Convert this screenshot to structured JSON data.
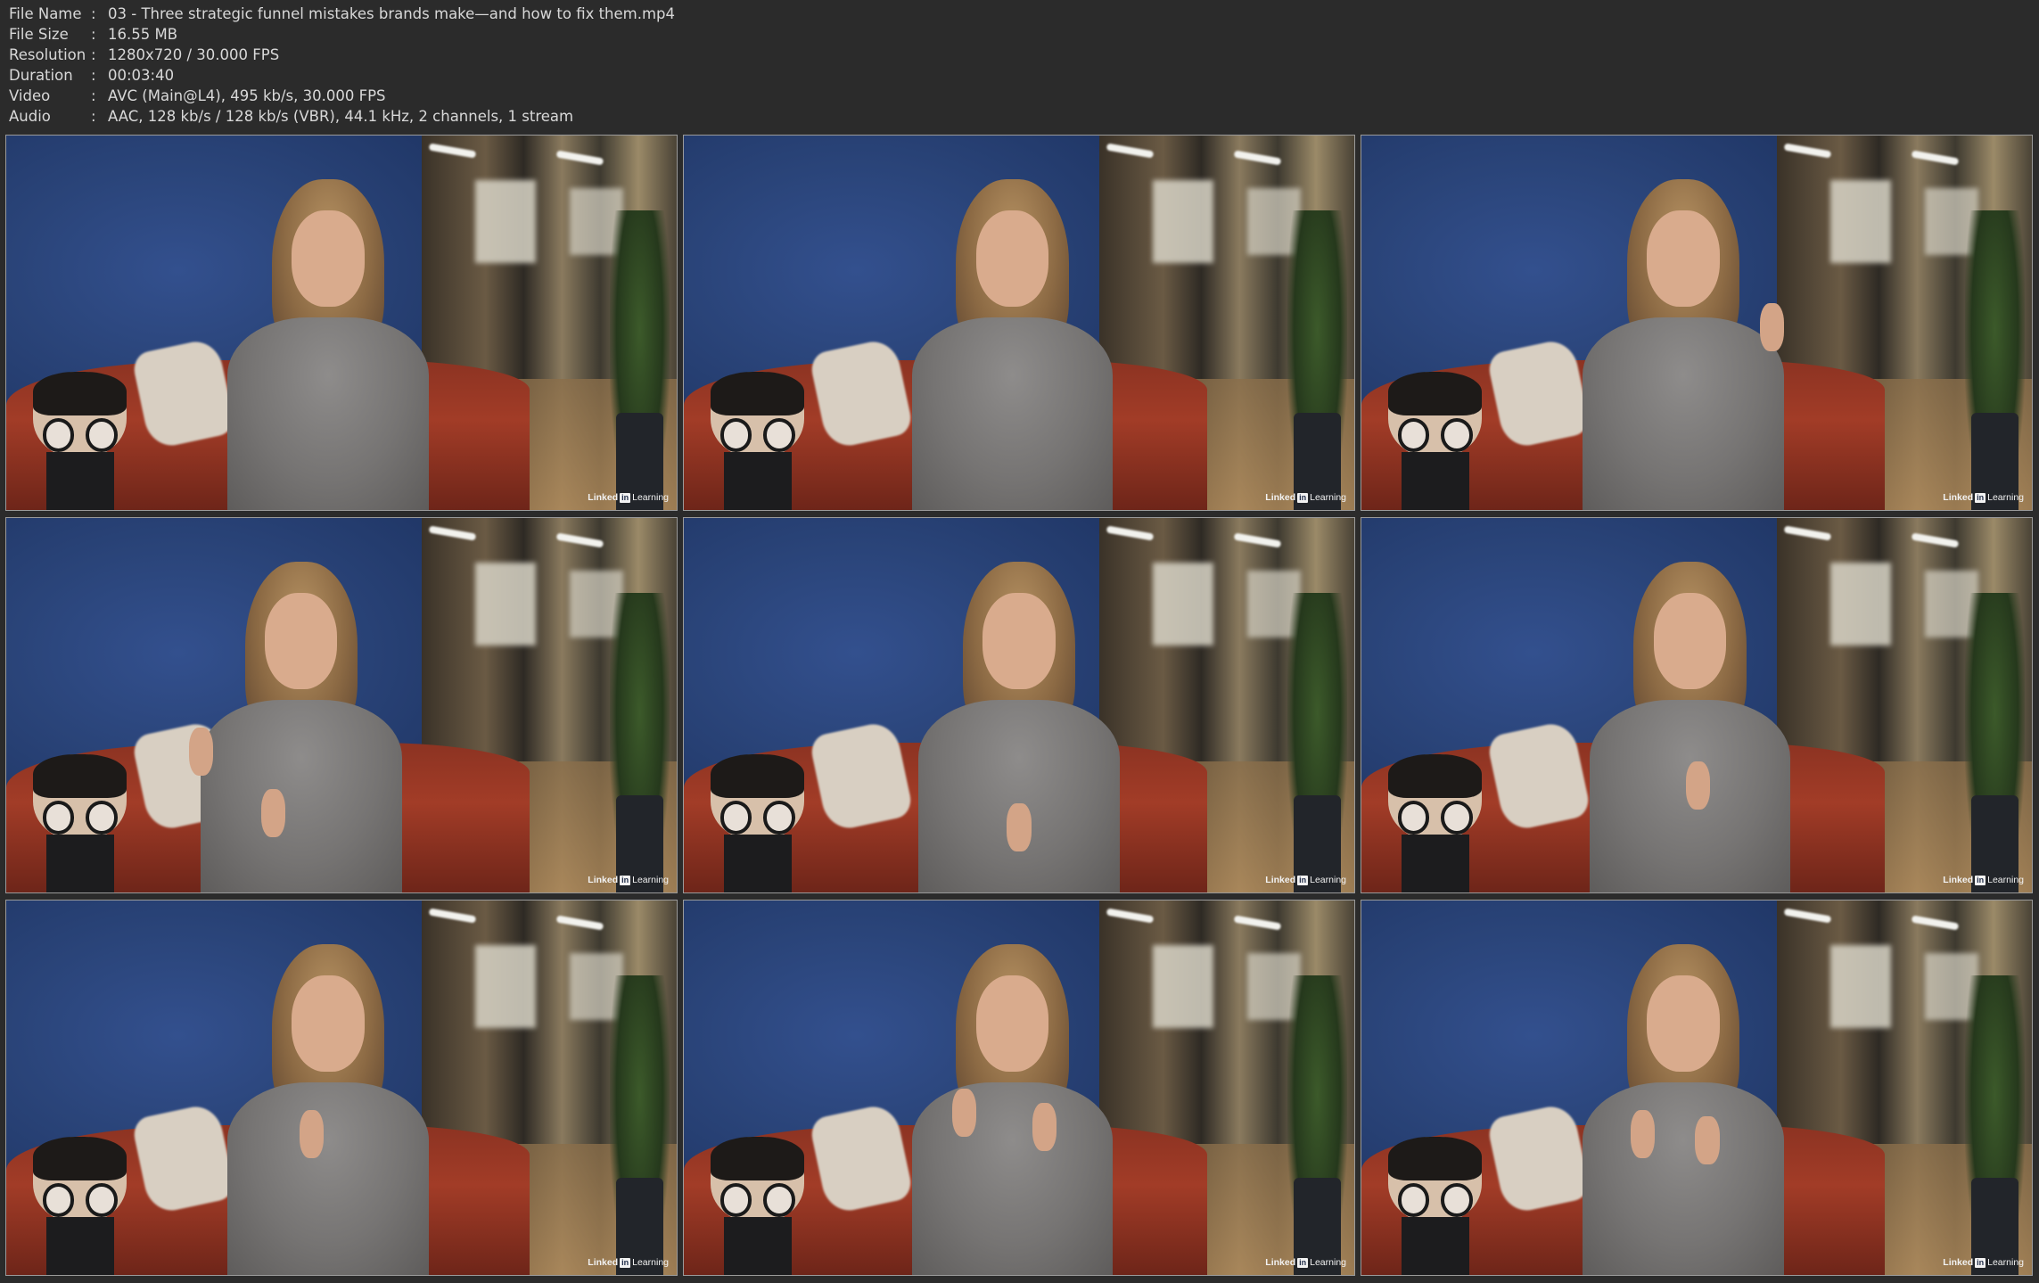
{
  "metadata": [
    {
      "label": "File Name",
      "value": "03 - Three strategic funnel mistakes brands make—and how to fix them.mp4"
    },
    {
      "label": "File Size",
      "value": "16.55 MB"
    },
    {
      "label": "Resolution",
      "value": "1280x720 / 30.000 FPS"
    },
    {
      "label": "Duration",
      "value": "00:03:40"
    },
    {
      "label": "Video",
      "value": "AVC (Main@L4), 495 kb/s, 30.000 FPS"
    },
    {
      "label": "Audio",
      "value": "AAC, 128 kb/s / 128 kb/s (VBR), 44.1 kHz, 2 channels, 1 stream"
    }
  ],
  "colon": ":",
  "watermark": {
    "linked": "Linked",
    "in": "in",
    "learning": "Learning"
  },
  "colors": {
    "background": "#2b2b2b",
    "text": "#d8d8d8",
    "frame_border": "#9a9a9a",
    "wall_blue": "#2a4479",
    "sofa_red": "#a23c27",
    "sweater_gray": "#767473"
  }
}
